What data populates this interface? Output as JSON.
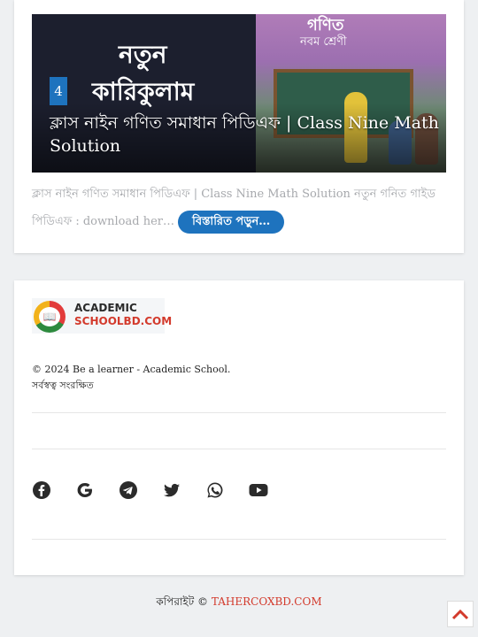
{
  "post": {
    "badge": "4",
    "title": "ক্লাস নাইন গণিত সমাধান পিডিএফ | Class Nine Math Solution",
    "excerpt": "ক্লাস নাইন গণিত সমাধান পিডিএফ | Class Nine Math Solution নতুন গনিত গাইড পিডিএফ : download her…",
    "read_more": "বিস্তারিত পড়ুন…",
    "image_text": {
      "left_line1": "নতুন",
      "left_line2": "কারিকুলাম",
      "cover_title": "গণিত",
      "cover_subtitle": "নবম শ্রেণী"
    }
  },
  "footer": {
    "logo_line1": "ACADEMIC",
    "logo_line2": "SCHOOLBD.COM",
    "copyright_line1": "© 2024 Be a learner - Academic School.",
    "copyright_line2": "সর্বস্বত্ব সংরক্ষিত",
    "social_icons": [
      "facebook-icon",
      "google-icon",
      "telegram-icon",
      "twitter-icon",
      "whatsapp-icon",
      "youtube-icon"
    ]
  },
  "site_footer": {
    "prefix": "কপিরাইট ©",
    "link": "TAHERCOXBD.COM"
  },
  "colors": {
    "accent": "#1e73be",
    "brand_red": "#d33a2c",
    "background": "#eef0f2"
  }
}
